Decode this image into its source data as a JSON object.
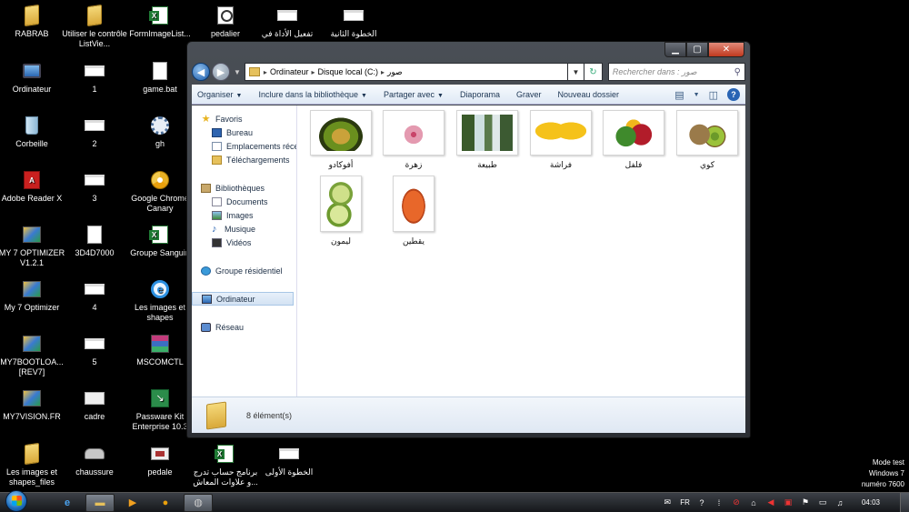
{
  "desktop_icons": [
    {
      "label": "RABRAB",
      "icon": "folder-icon"
    },
    {
      "label": "Utiliser le contrôle ListVie...",
      "icon": "folder-icon"
    },
    {
      "label": "FormImageList...",
      "icon": "excel-file-icon"
    },
    {
      "label": "pedalier",
      "icon": "image-file-icon"
    },
    {
      "label": "تفعيل الأداة في",
      "icon": "note-file-icon"
    },
    {
      "label": "الخطوة الثانية",
      "icon": "note-file-icon"
    },
    {
      "label": "Ordinateur",
      "icon": "computer-icon"
    },
    {
      "label": "1",
      "icon": "note-file-icon"
    },
    {
      "label": "game.bat",
      "icon": "batch-file-icon"
    },
    {
      "label": "Corbeille",
      "icon": "recycle-bin-icon"
    },
    {
      "label": "2",
      "icon": "note-file-icon"
    },
    {
      "label": "gh",
      "icon": "gear-icon"
    },
    {
      "label": "Adobe Reader X",
      "icon": "pdf-icon"
    },
    {
      "label": "3",
      "icon": "note-file-icon"
    },
    {
      "label": "Google Chrome Canary",
      "icon": "chrome-canary-icon"
    },
    {
      "label": "MY 7 OPTIMIZER V1.2.1",
      "icon": "app-icon"
    },
    {
      "label": "3D4D7000",
      "icon": "document-icon"
    },
    {
      "label": "Groupe Sanguin",
      "icon": "excel-file-icon"
    },
    {
      "label": "My 7 Optimizer",
      "icon": "app-icon"
    },
    {
      "label": "4",
      "icon": "note-file-icon"
    },
    {
      "label": "Les images et shapes",
      "icon": "internet-explorer-icon"
    },
    {
      "label": "MY7BOOTLOA... [REV7]",
      "icon": "app-icon"
    },
    {
      "label": "5",
      "icon": "note-file-icon"
    },
    {
      "label": "MSCOMCTL",
      "icon": "winrar-icon"
    },
    {
      "label": "MY7VISION.FR",
      "icon": "app-icon"
    },
    {
      "label": "cadre",
      "icon": "image-file-icon"
    },
    {
      "label": "Passware Kit Enterprise 10.3",
      "icon": "passware-icon"
    },
    {
      "label": "Les images et shapes_files",
      "icon": "folder-icon"
    },
    {
      "label": "chaussure",
      "icon": "shoe-image-icon"
    },
    {
      "label": "pedale",
      "icon": "pedal-image-icon"
    },
    {
      "label": "برنامج حساب تدرج ...و علاوات المعاش",
      "icon": "excel-file-icon"
    },
    {
      "label": "الخطوة الأولى",
      "icon": "note-file-icon"
    }
  ],
  "window": {
    "controls": {
      "minimize": "▁",
      "maximize": "▢",
      "close": "✕"
    },
    "address": {
      "crumbs": [
        "Ordinateur",
        "Disque local (C:)",
        "صور"
      ],
      "separator": "▸"
    },
    "search": {
      "placeholder": "Rechercher dans : صور",
      "icon": "search-icon"
    },
    "toolbar": {
      "items": [
        "Organiser",
        "Inclure dans la bibliothèque",
        "Partager avec",
        "Diaporama",
        "Graver",
        "Nouveau dossier"
      ],
      "dropdown_caret": "▼"
    },
    "nav_pane": {
      "favorites": {
        "label": "Favoris",
        "items": [
          "Bureau",
          "Emplacements récen",
          "Téléchargements"
        ]
      },
      "libraries": {
        "label": "Bibliothèques",
        "items": [
          "Documents",
          "Images",
          "Musique",
          "Vidéos"
        ]
      },
      "homegroup": "Groupe résidentiel",
      "computer": "Ordinateur",
      "network": "Réseau"
    },
    "files": [
      {
        "name": "أفوكادو",
        "thumb": "avocado"
      },
      {
        "name": "زهرة",
        "thumb": "lily"
      },
      {
        "name": "طبيعة",
        "thumb": "waterfall"
      },
      {
        "name": "فراشة",
        "thumb": "butterfly"
      },
      {
        "name": "فلفل",
        "thumb": "peppers"
      },
      {
        "name": "كوي",
        "thumb": "kiwi"
      },
      {
        "name": "ليمون",
        "thumb": "lime"
      },
      {
        "name": "يقطين",
        "thumb": "pumpkin"
      }
    ],
    "details": {
      "count_text": "8 élément(s)"
    }
  },
  "taskbar": {
    "tray": {
      "language": "FR",
      "clock": "04:03"
    }
  },
  "watermark": {
    "line1": "Mode test",
    "line2": "Windows 7",
    "line3": "numéro 7600"
  }
}
